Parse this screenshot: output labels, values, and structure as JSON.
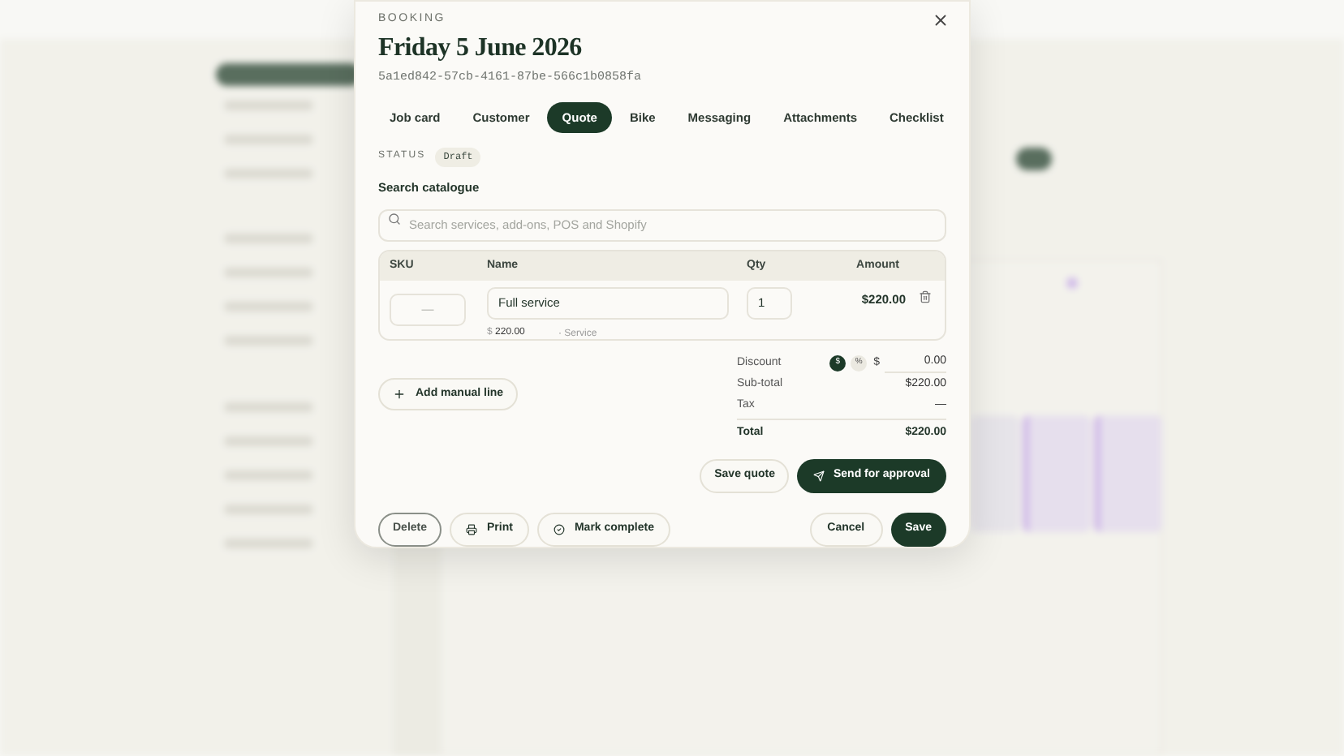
{
  "dialog": {
    "eyebrow": "BOOKING",
    "title": "Friday 5 June 2026",
    "id": "5a1ed842-57cb-4161-87be-566c1b0858fa"
  },
  "tabs": [
    {
      "label": "Job card",
      "selected": false
    },
    {
      "label": "Customer",
      "selected": false
    },
    {
      "label": "Quote",
      "selected": true
    },
    {
      "label": "Bike",
      "selected": false
    },
    {
      "label": "Messaging",
      "selected": false
    },
    {
      "label": "Attachments",
      "selected": false
    },
    {
      "label": "Checklist",
      "selected": false
    }
  ],
  "status": {
    "label": "STATUS",
    "value": "Draft"
  },
  "search": {
    "label": "Search catalogue",
    "placeholder": "Search services, add-ons, POS and Shopify"
  },
  "table": {
    "columns": [
      "SKU",
      "Name",
      "Qty",
      "Amount"
    ],
    "rows": [
      {
        "sku_placeholder": "—",
        "name": "Full service",
        "qty": "1",
        "amount": "$220.00",
        "price_prefix": "$",
        "price": "220.00",
        "type": "· Service"
      }
    ]
  },
  "add_line": "Add manual line",
  "summary": {
    "discount": {
      "label": "Discount",
      "modes": [
        {
          "label": "$",
          "selected": true
        },
        {
          "label": "%",
          "selected": false
        }
      ],
      "currency": "$",
      "value": "0.00"
    },
    "rows": [
      {
        "label": "Sub-total",
        "value": "$220.00"
      },
      {
        "label": "Tax",
        "value": "—"
      }
    ],
    "total": {
      "label": "Total",
      "value": "$220.00"
    }
  },
  "quote_actions": {
    "save": "Save quote",
    "send": "Send for approval"
  },
  "footer": {
    "delete": "Delete",
    "print": "Print",
    "complete": "Mark complete",
    "cancel": "Cancel",
    "save": "Save"
  }
}
